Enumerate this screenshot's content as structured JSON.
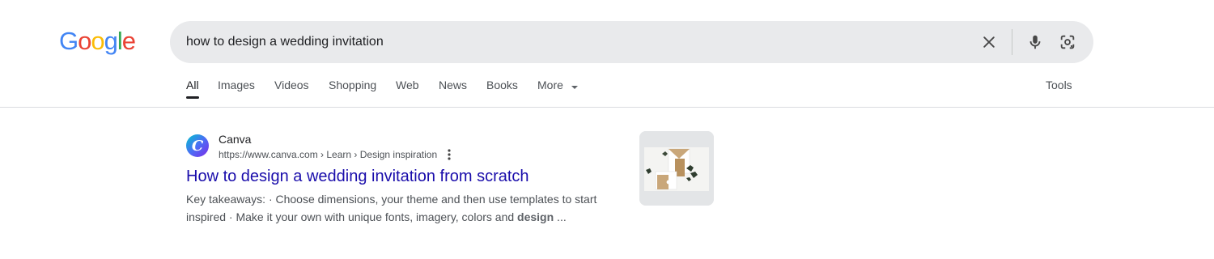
{
  "logo": {
    "letters": [
      "G",
      "o",
      "o",
      "g",
      "l",
      "e"
    ],
    "colors": [
      "#4285f4",
      "#ea4335",
      "#fbbc05",
      "#4285f4",
      "#34a853",
      "#ea4335"
    ]
  },
  "search": {
    "query": "how to design a wedding invitation",
    "clear_icon": "close-icon",
    "voice_icon": "microphone-icon",
    "lens_icon": "camera-lens-icon"
  },
  "tabs": [
    {
      "label": "All",
      "active": true
    },
    {
      "label": "Images"
    },
    {
      "label": "Videos"
    },
    {
      "label": "Shopping"
    },
    {
      "label": "Web"
    },
    {
      "label": "News"
    },
    {
      "label": "Books"
    },
    {
      "label": "More"
    }
  ],
  "tools_label": "Tools",
  "result": {
    "favicon_letter": "C",
    "site_name": "Canva",
    "url": "https://www.canva.com › Learn › Design inspiration",
    "title": "How to design a wedding invitation from scratch",
    "snippet_prefix": "Key takeaways: · Choose dimensions, your theme and then use templates to start inspired · Make it your own with unique fonts, imagery, colors and ",
    "snippet_bold": "design",
    "snippet_suffix": " ..."
  },
  "colors": {
    "link": "#1a0dab",
    "searchbox_bg": "#e9eaec",
    "muted_text": "#4d5156"
  }
}
